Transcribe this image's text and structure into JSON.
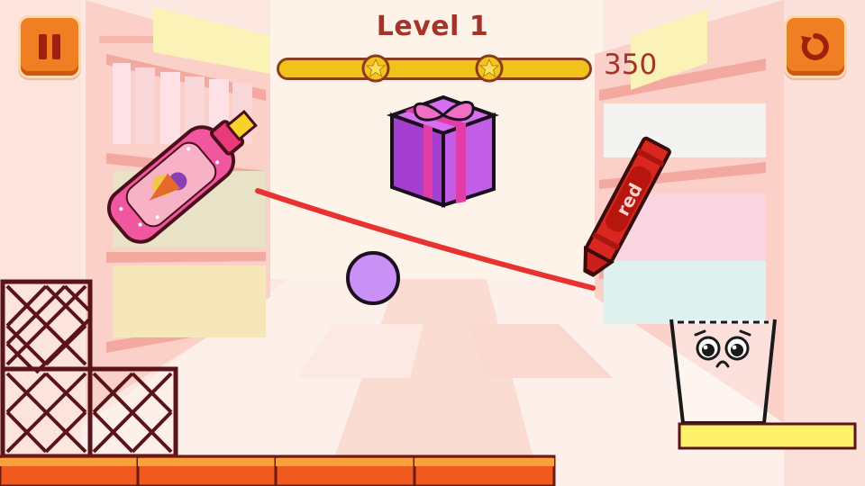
{
  "level": {
    "label": "Level 1"
  },
  "score": {
    "value": "350"
  },
  "progress": {
    "fraction": 1.0,
    "stars_earned": 2
  },
  "buttons": {
    "pause_icon": "pause-icon",
    "restart_icon": "restart-icon"
  },
  "crayon": {
    "label": "red"
  },
  "colors": {
    "background": "#fde6df",
    "button_orange": "#ef7f22",
    "text_red": "#a6332a",
    "progress_yellow": "#f4e64d",
    "drawn_line": "#e8322f",
    "ball": "#c990f5",
    "gift": "#b94fe0",
    "gift_ribbon": "#e23ca8",
    "bottle": "#f0579f",
    "crayon": "#d9271f",
    "platform_yellow": "#fff26b",
    "crate_frame": "#5a1419",
    "floor_brick": "#f05a1e"
  }
}
